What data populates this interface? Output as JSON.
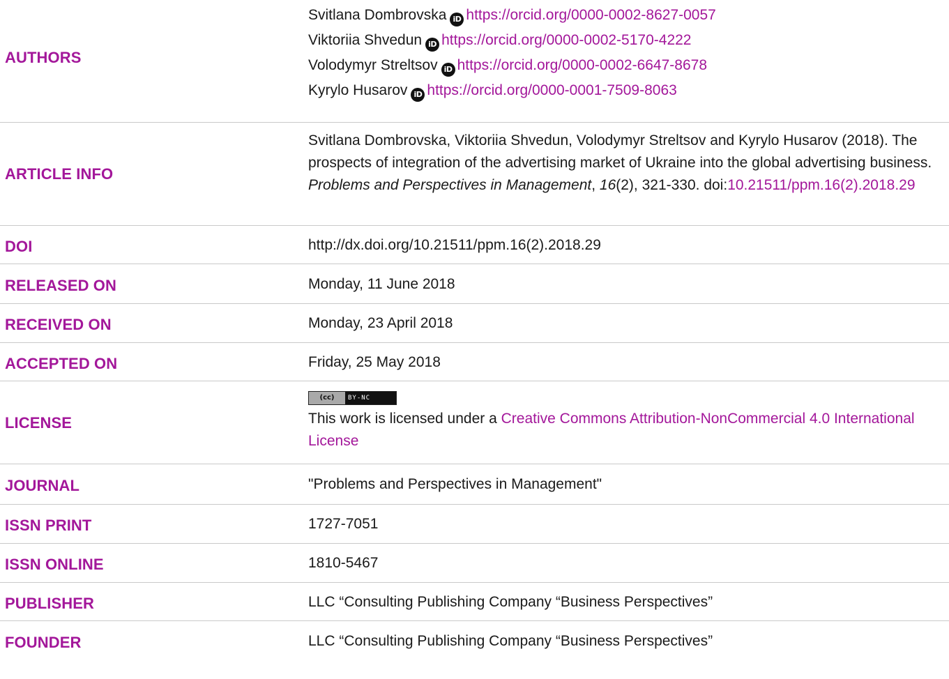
{
  "authors": {
    "label": "AUTHORS",
    "list": [
      {
        "name": "Svitlana Dombrovska",
        "orcid_icon": "iD",
        "orcid_url": "https://orcid.org/0000-0002-8627-0057"
      },
      {
        "name": "Viktoriia Shvedun",
        "orcid_icon": "iD",
        "orcid_url": "https://orcid.org/0000-0002-5170-4222"
      },
      {
        "name": "Volodymyr Streltsov",
        "orcid_icon": "iD",
        "orcid_url": "https://orcid.org/0000-0002-6647-8678"
      },
      {
        "name": "Kyrylo Husarov",
        "orcid_icon": "iD",
        "orcid_url": "https://orcid.org/0000-0001-7509-8063"
      }
    ]
  },
  "article_info": {
    "label": "ARTICLE INFO",
    "citation_pre": "Svitlana Dombrovska, Viktoriia Shvedun, Volodymyr Streltsov and Kyrylo Husarov (2018). The prospects of integration of the advertising market of Ukraine into the global advertising business. ",
    "journal_italic": "Problems and Perspectives in Management",
    "comma": ", ",
    "volume_italic": "16",
    "citation_post": "(2), 321-330. doi:",
    "doi_link": "10.21511/ppm.16(2).2018.29"
  },
  "doi": {
    "label": "DOI",
    "value": "http://dx.doi.org/10.21511/ppm.16(2).2018.29"
  },
  "released_on": {
    "label": "RELEASED ON",
    "value": "Monday, 11 June 2018"
  },
  "received_on": {
    "label": "RECEIVED ON",
    "value": "Monday, 23 April 2018"
  },
  "accepted_on": {
    "label": "ACCEPTED ON",
    "value": "Friday, 25 May 2018"
  },
  "license": {
    "label": "LICENSE",
    "badge_left": "(cc)",
    "badge_right": "BY-NC",
    "text_pre": "This work is licensed under a ",
    "link_text": "Creative Commons Attribution-NonCommercial 4.0 International License"
  },
  "journal": {
    "label": "JOURNAL",
    "value": "\"Problems and Perspectives in Management\""
  },
  "issn_print": {
    "label": "ISSN PRINT",
    "value": "1727-7051"
  },
  "issn_online": {
    "label": "ISSN ONLINE",
    "value": "1810-5467"
  },
  "publisher": {
    "label": "PUBLISHER",
    "value": "LLC “Consulting Publishing Company “Business Perspectives”"
  },
  "founder": {
    "label": "FOUNDER",
    "value": "LLC “Consulting Publishing Company “Business Perspectives”"
  },
  "colors": {
    "accent": "#a3179a",
    "text": "#1a1a1a",
    "divider": "#c9c9c9"
  }
}
